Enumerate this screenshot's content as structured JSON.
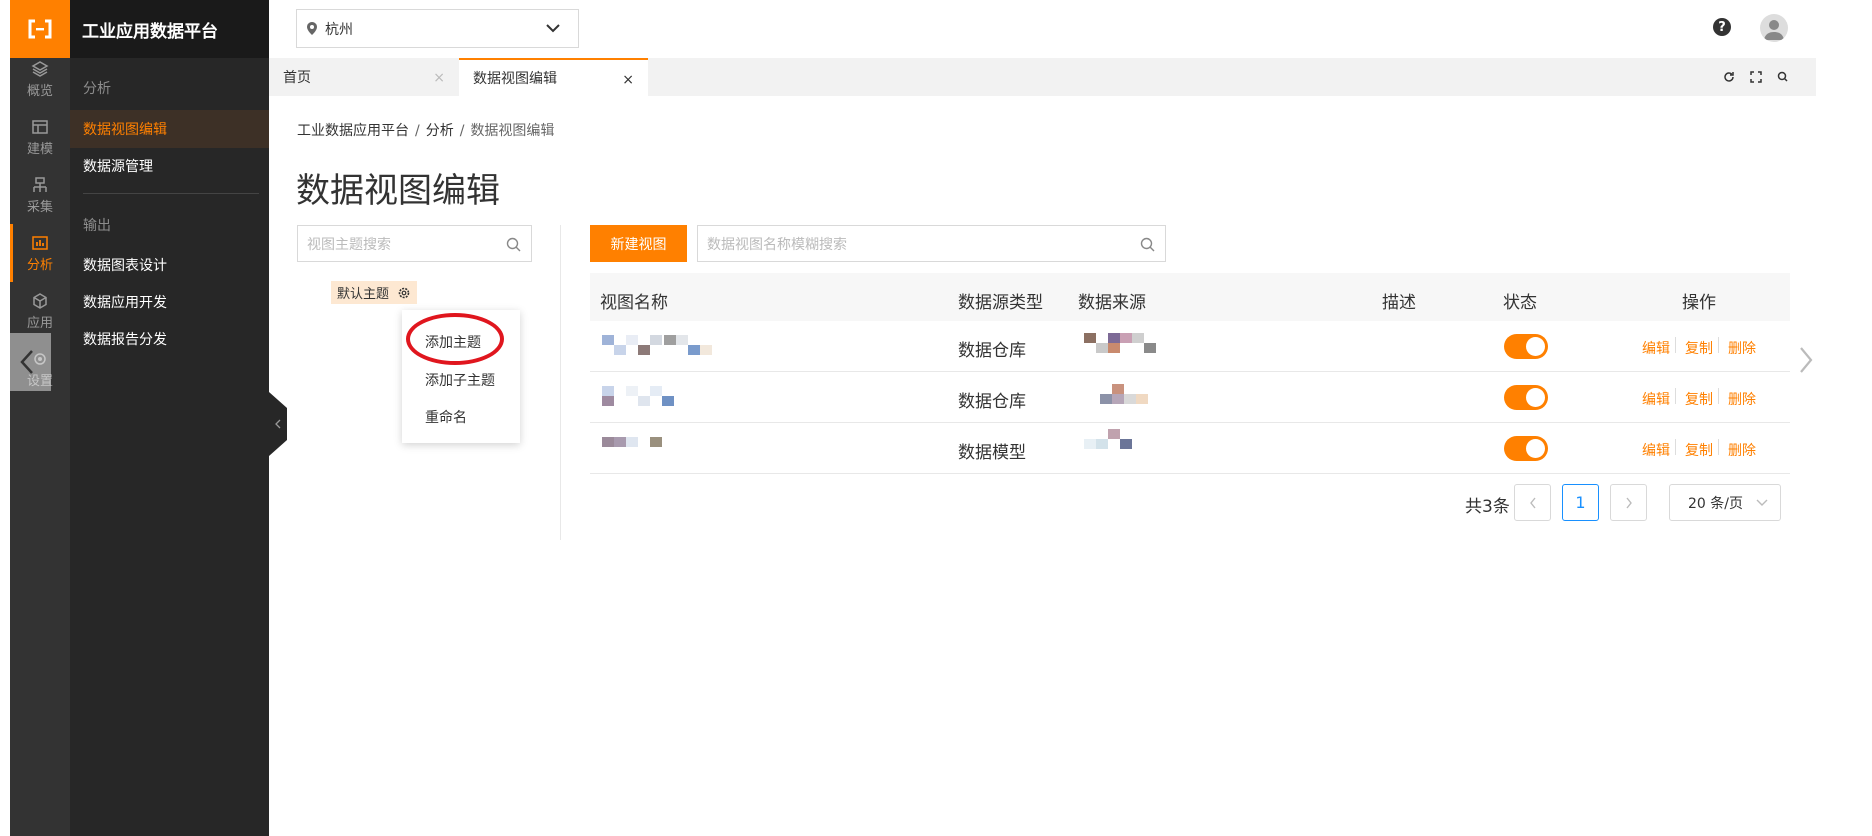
{
  "app": {
    "brand": "工业应用数据平台"
  },
  "rail": [
    {
      "label": "概览",
      "icon": "layers-icon"
    },
    {
      "label": "建模",
      "icon": "table-icon"
    },
    {
      "label": "采集",
      "icon": "network-icon"
    },
    {
      "label": "分析",
      "icon": "chart-icon",
      "active": true
    },
    {
      "label": "应用",
      "icon": "cube-icon"
    },
    {
      "label": "设置",
      "icon": "gear-icon"
    }
  ],
  "menu": {
    "group1": "分析",
    "items1": [
      "数据视图编辑",
      "数据源管理"
    ],
    "group2": "输出",
    "items2": [
      "数据图表设计",
      "数据应用开发",
      "数据报告分发"
    ]
  },
  "topbar": {
    "city": "杭州",
    "help": "?"
  },
  "tabs": [
    {
      "label": "首页",
      "close": "×"
    },
    {
      "label": "数据视图编辑",
      "close": "×",
      "active": true
    }
  ],
  "breadcrumb": {
    "root": "工业数据应用平台",
    "mid": "分析",
    "current": "数据视图编辑",
    "sep": "/"
  },
  "page_title": "数据视图编辑",
  "topic_search": {
    "placeholder": "视图主题搜索"
  },
  "topic": {
    "label": "默认主题"
  },
  "context_menu": [
    "添加主题",
    "添加子主题",
    "重命名"
  ],
  "toolbar": {
    "new_button": "新建视图",
    "search_placeholder": "数据视图名称模糊搜索"
  },
  "table": {
    "headers": [
      "视图名称",
      "数据源类型",
      "数据来源",
      "描述",
      "状态",
      "操作"
    ],
    "rows": [
      {
        "type": "数据仓库",
        "enabled": true
      },
      {
        "type": "数据仓库",
        "enabled": true
      },
      {
        "type": "数据模型",
        "enabled": true
      }
    ],
    "actions": [
      "编辑",
      "复制",
      "删除"
    ]
  },
  "pagination": {
    "total": "共3条",
    "current": "1",
    "page_size": "20 条/页"
  },
  "colors": {
    "accent": "#ff8000",
    "sidebar": "#333333",
    "submenu": "#272727",
    "highlight_ring": "#e0161e"
  }
}
